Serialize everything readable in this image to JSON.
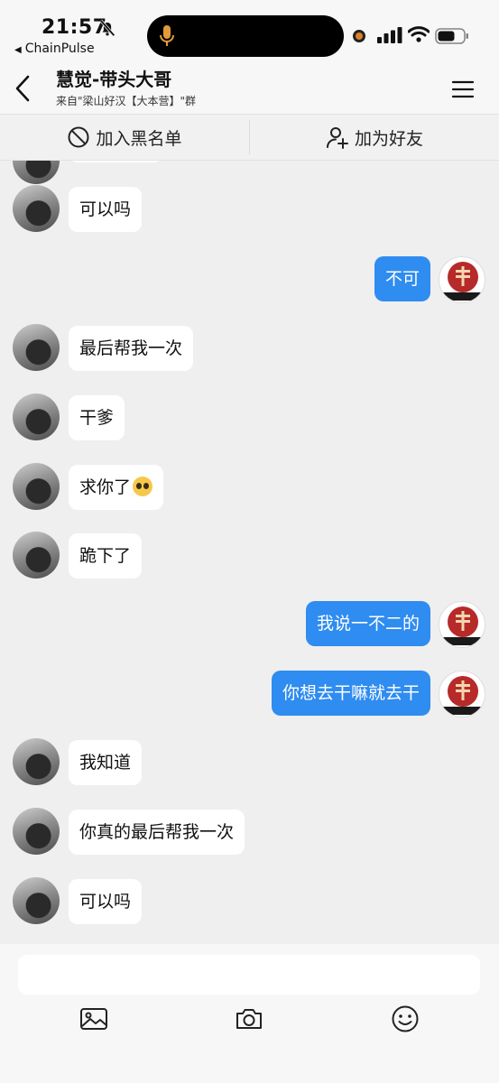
{
  "status_bar": {
    "time": "21:57",
    "back_app": "ChainPulse",
    "back_glyph": "◀"
  },
  "header": {
    "title": "慧觉-带头大哥",
    "subtitle": "来自\"梁山好汉【大本营】\"群"
  },
  "actions": {
    "blacklist_label": "加入黑名单",
    "add_friend_label": "加为好友"
  },
  "messages": [
    {
      "side": "left",
      "text": "可以吗"
    },
    {
      "side": "right",
      "text": "不可"
    },
    {
      "side": "left",
      "text": "最后帮我一次"
    },
    {
      "side": "left",
      "text": "干爹"
    },
    {
      "side": "left",
      "text": "求你了"
    },
    {
      "side": "left",
      "text": "跪下了"
    },
    {
      "side": "right",
      "text": "我说一不二的"
    },
    {
      "side": "right",
      "text": "你想去干嘛就去干"
    },
    {
      "side": "left",
      "text": "我知道"
    },
    {
      "side": "left",
      "text": "你真的最后帮我一次"
    },
    {
      "side": "left",
      "text": "可以吗"
    }
  ],
  "composer": {
    "placeholder": ""
  },
  "colors": {
    "accent": "#2f8cf0",
    "background": "#efefef",
    "bubble_in": "#ffffff"
  }
}
